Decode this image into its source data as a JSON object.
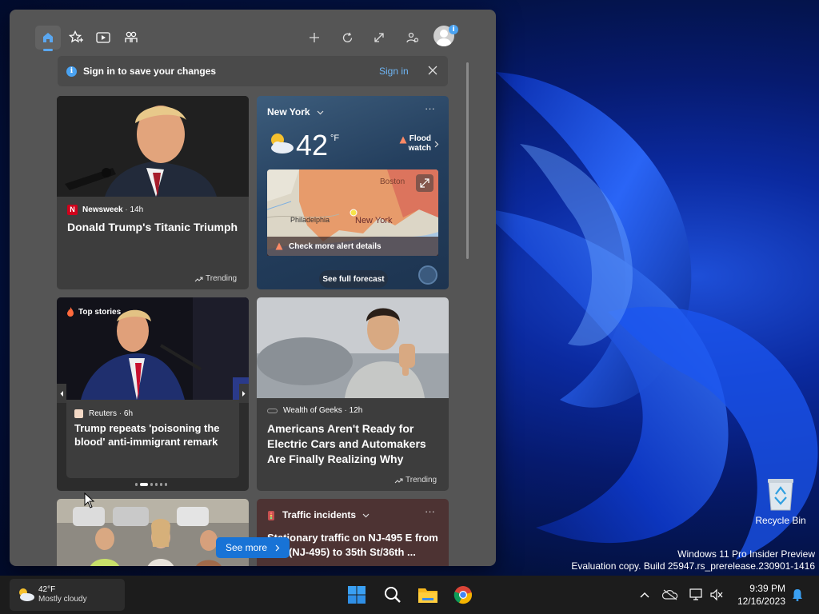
{
  "widgets": {
    "toolbar": {
      "tabs": [
        {
          "name": "home",
          "icon": "home-icon"
        },
        {
          "name": "following",
          "icon": "star-plus-icon"
        },
        {
          "name": "video",
          "icon": "play-icon"
        },
        {
          "name": "people",
          "icon": "people-icon"
        }
      ],
      "actions": [
        "add-icon",
        "refresh-icon",
        "expand-icon",
        "people-settings-icon"
      ],
      "avatar_badge": "i"
    },
    "signin_bar": {
      "message": "Sign in to save your changes",
      "link": "Sign in"
    },
    "cards": {
      "newsweek": {
        "source": "Newsweek",
        "age": "14h",
        "title": "Donald Trump's Titanic Triumph",
        "trend_label": "Trending"
      },
      "weather": {
        "location": "New York",
        "temp": "42",
        "unit": "°F",
        "alert": "Flood watch",
        "map_labels": [
          "Boston",
          "Philadelphia",
          "New York"
        ],
        "alert_details": "Check more alert details",
        "forecast_button": "See full forecast",
        "condition_icon": "sun-behind-cloud-icon"
      },
      "top_stories": {
        "label": "Top stories",
        "source": "Reuters",
        "age": "6h",
        "title": "Trump repeats 'poisoning the blood' anti-immigrant remark",
        "page_index": 2,
        "page_count": 6
      },
      "geeks": {
        "source": "Wealth of Geeks",
        "age": "12h",
        "title": "Americans Aren't Ready for Electric Cars and Automakers Are Finally Realizing Why",
        "trend_label": "Trending"
      },
      "traffic": {
        "label": "Traffic incidents",
        "line1": "Stationary traffic on NJ-495 E from",
        "line2": "Ave (NJ-495) to 35th St/36th ..."
      }
    },
    "see_more": "See more"
  },
  "desktop": {
    "recycle_bin": "Recycle Bin",
    "watermark_line1": "Windows 11 Pro Insider Preview",
    "watermark_line2": "Evaluation copy. Build 25947.rs_prerelease.230901-1416"
  },
  "taskbar": {
    "weather": {
      "temp": "42°F",
      "condition": "Mostly cloudy"
    },
    "apps": [
      "start-icon",
      "search-icon",
      "file-explorer-icon",
      "chrome-icon"
    ],
    "tray": [
      "chevron-up-icon",
      "onedrive-offline-icon",
      "network-icon",
      "volume-muted-icon"
    ],
    "time": "9:39 PM",
    "date": "12/16/2023"
  },
  "colors": {
    "accent": "#1873d6",
    "link": "#6fb6f5",
    "panel_bg": "#555555",
    "card_bg": "#3d3d3d"
  }
}
